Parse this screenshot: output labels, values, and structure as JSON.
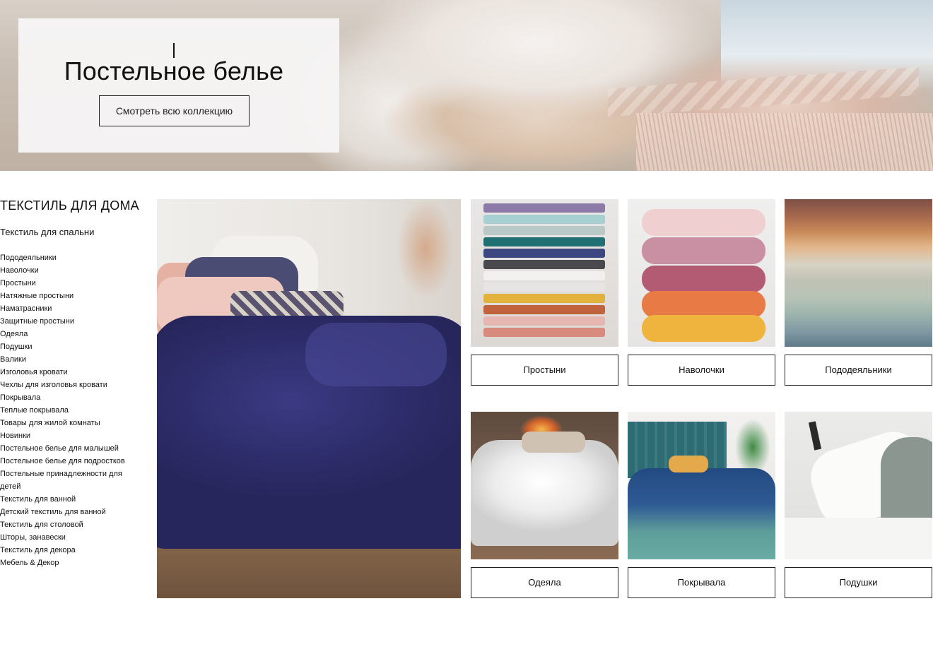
{
  "hero": {
    "title": "Постельное белье",
    "button_label": "Смотреть всю коллекцию"
  },
  "sidebar": {
    "heading": "ТЕКСТИЛЬ ДЛЯ ДОМА",
    "subheading": "Текстиль для спальни",
    "items": [
      "Пододеяльники",
      "Наволочки",
      "Простыни",
      "Натяжные простыни",
      "Наматрасники",
      "Защитные простыни",
      "Одеяла",
      "Подушки",
      "Валики",
      "Изголовья кровати",
      "Чехлы для изголовья кровати",
      "Покрывала",
      "Теплые покрывала",
      "Товары для жилой комнаты",
      "Новинки",
      "Постельное белье для малышей",
      "Постельное белье для подростков",
      "Постельные принадлежности для детей",
      "Текстиль для ванной",
      "Детский текстиль для ванной",
      "Текстиль для столовой",
      "Шторы, занавески",
      "Текстиль для декора",
      "Мебель & Декор"
    ]
  },
  "tiles": [
    {
      "label": "Простыни"
    },
    {
      "label": "Наволочки"
    },
    {
      "label": "Пододеяльники"
    },
    {
      "label": "Одеяла"
    },
    {
      "label": "Покрывала"
    },
    {
      "label": "Подушки"
    }
  ],
  "colors": {
    "text": "#111111",
    "border": "#222222",
    "hero_card": "#f6f5f5"
  }
}
